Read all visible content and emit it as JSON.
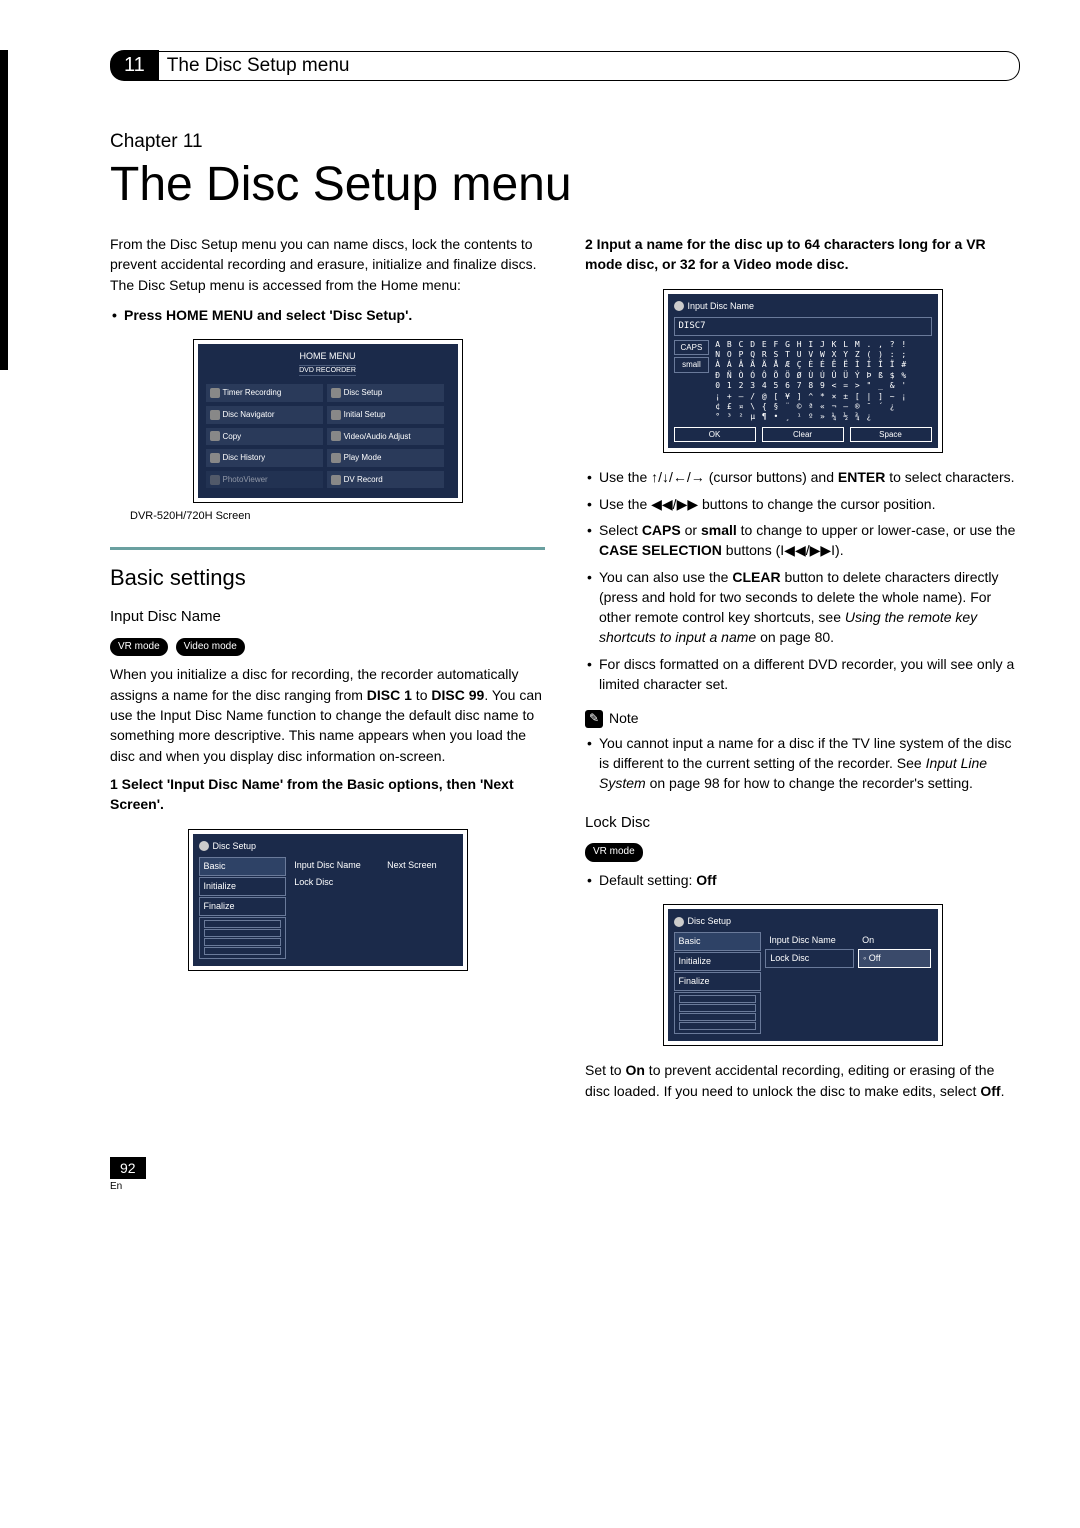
{
  "header": {
    "chapterNum": "11",
    "headerTitle": "The Disc Setup menu"
  },
  "chapter": {
    "label": "Chapter 11",
    "title": "The Disc Setup menu"
  },
  "leftCol": {
    "intro": "From the Disc Setup menu you can name discs, lock the contents to prevent accidental recording and erasure, initialize and finalize discs. The Disc Setup menu is accessed from the Home menu:",
    "pressBullet": "Press HOME MENU and select 'Disc Setup'.",
    "homeMenu": {
      "title": "HOME MENU",
      "sub": "DVD RECORDER",
      "items": [
        "Timer Recording",
        "Disc Setup",
        "Disc Navigator",
        "Initial Setup",
        "Copy",
        "Video/Audio Adjust",
        "Disc History",
        "Play Mode",
        "PhotoViewer",
        "DV Record"
      ],
      "caption": "DVR-520H/720H Screen"
    },
    "basic": {
      "heading": "Basic settings",
      "inputDiscName": "Input Disc Name",
      "pillVR": "VR mode",
      "pillVideo": "Video mode",
      "para1a": "When you initialize a disc for recording, the recorder automatically assigns a name for the disc ranging from ",
      "disc1": "DISC 1",
      "to": " to ",
      "disc99": "DISC 99",
      "para1b": ". You can use the Input Disc Name function to change the default disc name to something more descriptive. This name appears when you load the disc and when you display disc information on-screen.",
      "step1": "1    Select 'Input Disc Name' from the Basic options, then 'Next Screen'.",
      "ds": {
        "title": "Disc Setup",
        "left": [
          "Basic",
          "Initialize",
          "Finalize"
        ],
        "mid": [
          "Input Disc Name",
          "Lock Disc"
        ],
        "right": [
          "Next Screen"
        ]
      }
    }
  },
  "rightCol": {
    "step2": "2    Input a name for the disc up to 64 characters long for a VR mode disc, or 32 for a Video mode disc.",
    "kbd": {
      "title": "Input Disc Name",
      "top": "DISC7",
      "caps": "CAPS",
      "small": "small",
      "rows": [
        "A B C D E F G H I J K L M . , ? !",
        "N O P Q R S T U V W X Y Z ( ) : ;",
        "À Á Â Ã Ä Å Æ Ç È É Ê Ë Ì Í Î Ï #",
        "Ð Ñ Ò Ó Ô Õ Ö Ø Ù Ú Û Ü Ý Þ ß $ %",
        "0 1 2 3 4 5 6 7 8 9 < = > \" _ & '",
        "¡ + – / @ [ ¥ ] ^ * × ± [ | ] ~ ¡",
        "¢ £ ¤ \\ { § ¨ © ª « ¬ – ® ¯ ´ ¿",
        "° ³ ² µ ¶ • ¸ ¹ º » ¼ ½ ¾ ¿"
      ],
      "ok": "OK",
      "clear": "Clear",
      "space": "Space"
    },
    "b1a": "Use the ",
    "b1b": " (cursor buttons) and ",
    "enter": "ENTER",
    "b1c": " to select characters.",
    "b2a": "Use the ",
    "b2b": " buttons to change the cursor position.",
    "b3a": "Select ",
    "caps": "CAPS",
    "b3b": " or ",
    "small": "small",
    "b3c": " to change to upper or lower-case, or use the ",
    "caseSel": "CASE SELECTION",
    "b3d": " buttons (",
    "b3e": ").",
    "b4a": "You can also use the ",
    "clear": "CLEAR",
    "b4b": " button to delete characters directly (press and hold for two seconds to delete the whole name). For other remote control key shortcuts, see ",
    "b4link": "Using the remote key shortcuts to input a name",
    "b4c": " on page 80.",
    "b5": "For discs formatted on a different DVD recorder, you will see only a limited character set.",
    "noteLabel": "Note",
    "noteBody1": "You cannot input a name for a disc if the TV line system of the disc is different to the current setting of the recorder. See ",
    "noteEm": "Input Line System",
    "noteBody2": " on page 98 for how to change the recorder's setting.",
    "lockDisc": "Lock Disc",
    "pillVR": "VR mode",
    "defSet": "Default setting: ",
    "off": "Off",
    "ds2": {
      "title": "Disc Setup",
      "left": [
        "Basic",
        "Initialize",
        "Finalize"
      ],
      "mid": [
        "Input Disc Name",
        "Lock Disc"
      ],
      "rightOn": "On",
      "rightOff": "Off"
    },
    "setTo1": "Set to ",
    "on": "On",
    "setTo2": " to prevent accidental recording, editing or erasing of the disc loaded. If you need to unlock the disc to make edits, select ",
    "off2": "Off",
    "setTo3": "."
  },
  "footer": {
    "page": "92",
    "lang": "En"
  }
}
